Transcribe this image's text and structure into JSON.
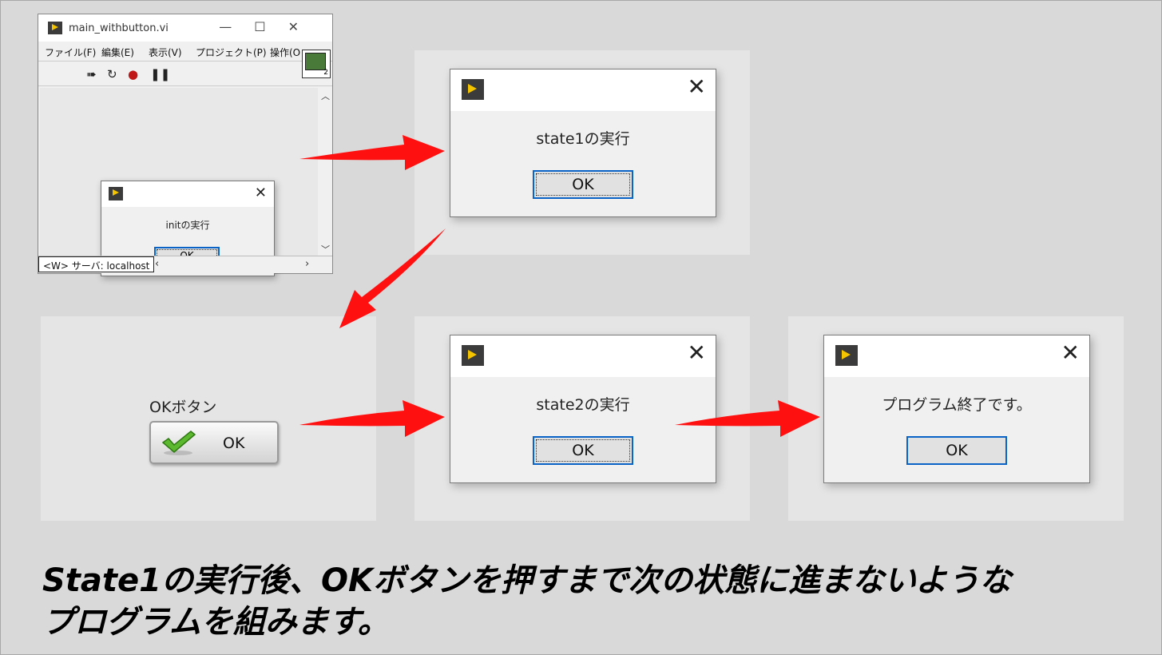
{
  "main_window": {
    "title": "main_withbutton.vi",
    "controls": {
      "minimize": "—",
      "maximize": "☐",
      "close": "✕"
    },
    "menu": [
      "ファイル(F)",
      "編集(E)",
      "表示(V)",
      "プロジェクト(P)",
      "操作(O"
    ],
    "vi_icon_number": "2",
    "server": "<W> サーバ: localhost",
    "init_dialog": {
      "message": "initの実行",
      "ok": "OK"
    }
  },
  "dialogs": {
    "state1": {
      "message": "state1の実行",
      "ok": "OK"
    },
    "state2": {
      "message": "state2の実行",
      "ok": "OK"
    },
    "end": {
      "message": "プログラム終了です。",
      "ok": "OK"
    }
  },
  "ok_button_control": {
    "label": "OKボタン",
    "button_text": "OK"
  },
  "caption": {
    "line1": "State1の実行後、OKボタンを押すまで次の状態に進まないような",
    "line2": "プログラムを組みます。"
  },
  "colors": {
    "arrow": "#ff1010",
    "accent": "#0a64c8",
    "logo_yellow": "#f5c400"
  }
}
